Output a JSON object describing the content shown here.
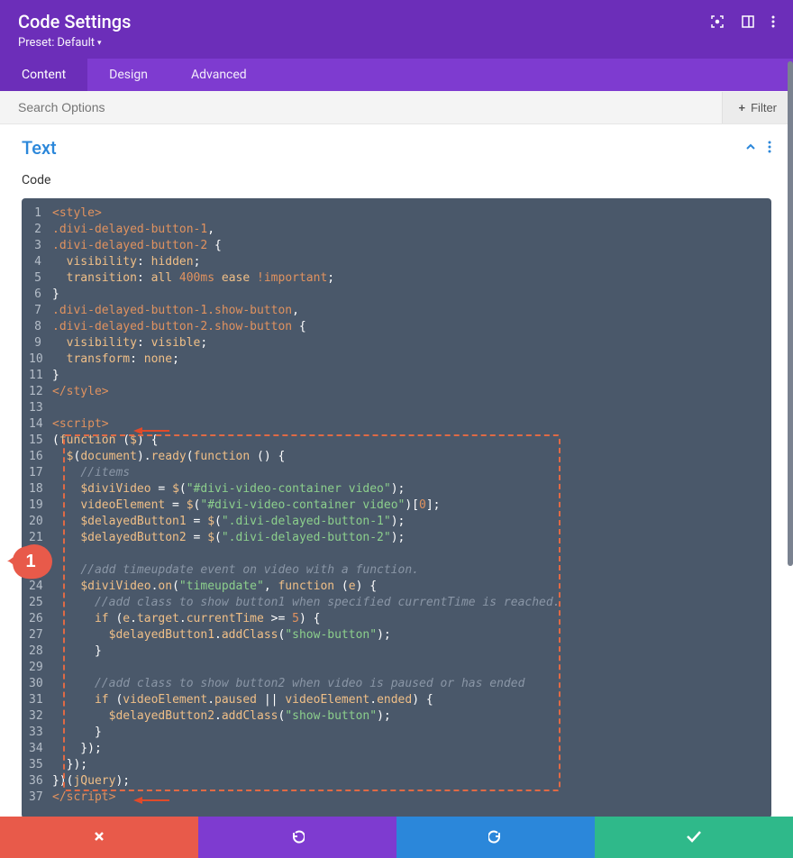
{
  "header": {
    "title": "Code Settings",
    "preset_label": "Preset:",
    "preset_value": "Default"
  },
  "tabs": [
    {
      "label": "Content",
      "active": true
    },
    {
      "label": "Design",
      "active": false
    },
    {
      "label": "Advanced",
      "active": false
    }
  ],
  "search": {
    "placeholder": "Search Options"
  },
  "filter": {
    "label": "Filter"
  },
  "section": {
    "title": "Text",
    "field_label": "Code"
  },
  "badge": {
    "num": "1"
  },
  "code_lines": [
    [
      {
        "c": "t-tag",
        "t": "<style>"
      }
    ],
    [
      {
        "c": "t-sel",
        "t": ".divi-delayed-button-1"
      },
      {
        "c": "t-punc",
        "t": ","
      }
    ],
    [
      {
        "c": "t-sel",
        "t": ".divi-delayed-button-2"
      },
      {
        "c": "t-punc",
        "t": " {"
      }
    ],
    [
      {
        "c": "t-punc",
        "t": "  "
      },
      {
        "c": "t-var",
        "t": "visibility"
      },
      {
        "c": "t-punc",
        "t": ": "
      },
      {
        "c": "t-var",
        "t": "hidden"
      },
      {
        "c": "t-punc",
        "t": ";"
      }
    ],
    [
      {
        "c": "t-punc",
        "t": "  "
      },
      {
        "c": "t-var",
        "t": "transition"
      },
      {
        "c": "t-punc",
        "t": ": "
      },
      {
        "c": "t-var",
        "t": "all"
      },
      {
        "c": "t-punc",
        "t": " "
      },
      {
        "c": "t-num",
        "t": "400ms"
      },
      {
        "c": "t-punc",
        "t": " "
      },
      {
        "c": "t-var",
        "t": "ease"
      },
      {
        "c": "t-punc",
        "t": " "
      },
      {
        "c": "t-num",
        "t": "!important"
      },
      {
        "c": "t-punc",
        "t": ";"
      }
    ],
    [
      {
        "c": "t-punc",
        "t": "}"
      }
    ],
    [
      {
        "c": "t-sel",
        "t": ".divi-delayed-button-1.show-button"
      },
      {
        "c": "t-punc",
        "t": ","
      }
    ],
    [
      {
        "c": "t-sel",
        "t": ".divi-delayed-button-2.show-button"
      },
      {
        "c": "t-punc",
        "t": " {"
      }
    ],
    [
      {
        "c": "t-punc",
        "t": "  "
      },
      {
        "c": "t-var",
        "t": "visibility"
      },
      {
        "c": "t-punc",
        "t": ": "
      },
      {
        "c": "t-var",
        "t": "visible"
      },
      {
        "c": "t-punc",
        "t": ";"
      }
    ],
    [
      {
        "c": "t-punc",
        "t": "  "
      },
      {
        "c": "t-var",
        "t": "transform"
      },
      {
        "c": "t-punc",
        "t": ": "
      },
      {
        "c": "t-var",
        "t": "none"
      },
      {
        "c": "t-punc",
        "t": ";"
      }
    ],
    [
      {
        "c": "t-punc",
        "t": "}"
      }
    ],
    [
      {
        "c": "t-tag",
        "t": "</style>"
      }
    ],
    [
      {
        "c": "t-punc",
        "t": ""
      }
    ],
    [
      {
        "c": "t-tag",
        "t": "<script>"
      }
    ],
    [
      {
        "c": "t-punc",
        "t": "("
      },
      {
        "c": "t-kw",
        "t": "function"
      },
      {
        "c": "t-punc",
        "t": " ("
      },
      {
        "c": "t-var",
        "t": "$"
      },
      {
        "c": "t-punc",
        "t": ") {"
      }
    ],
    [
      {
        "c": "t-punc",
        "t": "  "
      },
      {
        "c": "t-var",
        "t": "$"
      },
      {
        "c": "t-punc",
        "t": "("
      },
      {
        "c": "t-var",
        "t": "document"
      },
      {
        "c": "t-punc",
        "t": ")."
      },
      {
        "c": "t-var",
        "t": "ready"
      },
      {
        "c": "t-punc",
        "t": "("
      },
      {
        "c": "t-kw",
        "t": "function"
      },
      {
        "c": "t-punc",
        "t": " () {"
      }
    ],
    [
      {
        "c": "t-punc",
        "t": "    "
      },
      {
        "c": "t-com",
        "t": "//items"
      }
    ],
    [
      {
        "c": "t-punc",
        "t": "    "
      },
      {
        "c": "t-var",
        "t": "$diviVideo"
      },
      {
        "c": "t-punc",
        "t": " = "
      },
      {
        "c": "t-var",
        "t": "$"
      },
      {
        "c": "t-punc",
        "t": "("
      },
      {
        "c": "t-str",
        "t": "\"#divi-video-container video\""
      },
      {
        "c": "t-punc",
        "t": ");"
      }
    ],
    [
      {
        "c": "t-punc",
        "t": "    "
      },
      {
        "c": "t-var",
        "t": "videoElement"
      },
      {
        "c": "t-punc",
        "t": " = "
      },
      {
        "c": "t-var",
        "t": "$"
      },
      {
        "c": "t-punc",
        "t": "("
      },
      {
        "c": "t-str",
        "t": "\"#divi-video-container video\""
      },
      {
        "c": "t-punc",
        "t": ")["
      },
      {
        "c": "t-num",
        "t": "0"
      },
      {
        "c": "t-punc",
        "t": "];"
      }
    ],
    [
      {
        "c": "t-punc",
        "t": "    "
      },
      {
        "c": "t-var",
        "t": "$delayedButton1"
      },
      {
        "c": "t-punc",
        "t": " = "
      },
      {
        "c": "t-var",
        "t": "$"
      },
      {
        "c": "t-punc",
        "t": "("
      },
      {
        "c": "t-str",
        "t": "\".divi-delayed-button-1\""
      },
      {
        "c": "t-punc",
        "t": ");"
      }
    ],
    [
      {
        "c": "t-punc",
        "t": "    "
      },
      {
        "c": "t-var",
        "t": "$delayedButton2"
      },
      {
        "c": "t-punc",
        "t": " = "
      },
      {
        "c": "t-var",
        "t": "$"
      },
      {
        "c": "t-punc",
        "t": "("
      },
      {
        "c": "t-str",
        "t": "\".divi-delayed-button-2\""
      },
      {
        "c": "t-punc",
        "t": ");"
      }
    ],
    [
      {
        "c": "t-punc",
        "t": ""
      }
    ],
    [
      {
        "c": "t-punc",
        "t": "    "
      },
      {
        "c": "t-com",
        "t": "//add timeupdate event on video with a function."
      }
    ],
    [
      {
        "c": "t-punc",
        "t": "    "
      },
      {
        "c": "t-var",
        "t": "$diviVideo"
      },
      {
        "c": "t-punc",
        "t": "."
      },
      {
        "c": "t-var",
        "t": "on"
      },
      {
        "c": "t-punc",
        "t": "("
      },
      {
        "c": "t-str",
        "t": "\"timeupdate\""
      },
      {
        "c": "t-punc",
        "t": ", "
      },
      {
        "c": "t-kw",
        "t": "function"
      },
      {
        "c": "t-punc",
        "t": " ("
      },
      {
        "c": "t-var",
        "t": "e"
      },
      {
        "c": "t-punc",
        "t": ") {"
      }
    ],
    [
      {
        "c": "t-punc",
        "t": "      "
      },
      {
        "c": "t-com",
        "t": "//add class to show button1 when specified currentTime is reached."
      }
    ],
    [
      {
        "c": "t-punc",
        "t": "      "
      },
      {
        "cists": "",
        "c": "t-kw",
        "t": "if"
      },
      {
        "c": "t-punc",
        "t": " ("
      },
      {
        "c": "t-var",
        "t": "e"
      },
      {
        "c": "t-punc",
        "t": "."
      },
      {
        "c": "t-var",
        "t": "target"
      },
      {
        "c": "t-punc",
        "t": "."
      },
      {
        "c": "t-var",
        "t": "currentTime"
      },
      {
        "c": "t-punc",
        "t": " >= "
      },
      {
        "c": "t-num",
        "t": "5"
      },
      {
        "c": "t-punc",
        "t": ") {"
      }
    ],
    [
      {
        "c": "t-punc",
        "t": "        "
      },
      {
        "c": "t-var",
        "t": "$delayedButton1"
      },
      {
        "c": "t-punc",
        "t": "."
      },
      {
        "c": "t-var",
        "t": "addClass"
      },
      {
        "c": "t-punc",
        "t": "("
      },
      {
        "c": "t-str",
        "t": "\"show-button\""
      },
      {
        "c": "t-punc",
        "t": ");"
      }
    ],
    [
      {
        "c": "t-punc",
        "t": "      }"
      }
    ],
    [
      {
        "c": "t-punc",
        "t": ""
      }
    ],
    [
      {
        "c": "t-punc",
        "t": "      "
      },
      {
        "c": "t-com",
        "t": "//add class to show button2 when video is paused or has ended"
      }
    ],
    [
      {
        "c": "t-punc",
        "t": "      "
      },
      {
        "c": "t-kw",
        "t": "if"
      },
      {
        "c": "t-punc",
        "t": " ("
      },
      {
        "c": "t-var",
        "t": "videoElement"
      },
      {
        "c": "t-punc",
        "t": "."
      },
      {
        "c": "t-var",
        "t": "paused"
      },
      {
        "c": "t-punc",
        "t": " || "
      },
      {
        "c": "t-var",
        "t": "videoElement"
      },
      {
        "c": "t-punc",
        "t": "."
      },
      {
        "c": "t-var",
        "t": "ended"
      },
      {
        "c": "t-punc",
        "t": ") {"
      }
    ],
    [
      {
        "c": "t-punc",
        "t": "        "
      },
      {
        "c": "t-var",
        "t": "$delayedButton2"
      },
      {
        "c": "t-punc",
        "t": "."
      },
      {
        "c": "t-var",
        "t": "addClass"
      },
      {
        "c": "t-punc",
        "t": "("
      },
      {
        "c": "t-str",
        "t": "\"show-button\""
      },
      {
        "c": "t-punc",
        "t": ");"
      }
    ],
    [
      {
        "c": "t-punc",
        "t": "      }"
      }
    ],
    [
      {
        "c": "t-punc",
        "t": "    });"
      }
    ],
    [
      {
        "c": "t-punc",
        "t": "  });"
      }
    ],
    [
      {
        "c": "t-punc",
        "t": "})("
      },
      {
        "c": "t-var",
        "t": "jQuery"
      },
      {
        "c": "t-punc",
        "t": ");"
      }
    ],
    [
      {
        "c": "t-tag",
        "t": "</script>"
      }
    ]
  ]
}
